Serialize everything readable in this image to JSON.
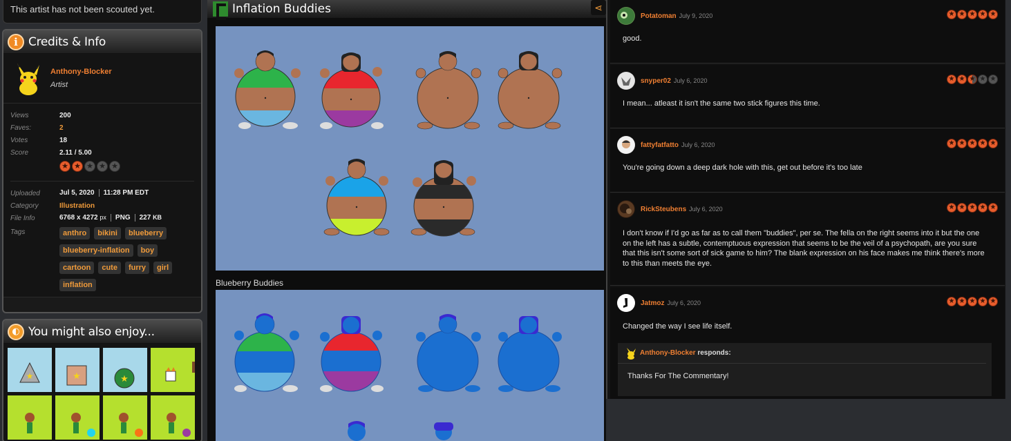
{
  "scout_text": "This artist has not been scouted yet.",
  "credits": {
    "title": "Credits & Info",
    "artist": {
      "name": "Anthony-Blocker",
      "role": "Artist"
    },
    "stats": [
      {
        "key": "Views",
        "value": "200"
      },
      {
        "key": "Faves:",
        "value": "2"
      },
      {
        "key": "Votes",
        "value": "18"
      },
      {
        "key": "Score",
        "value": "2.11 / 5.00"
      }
    ],
    "score_fraction": 0.422,
    "uploaded_label": "Uploaded",
    "uploaded_date": "Jul 5, 2020",
    "uploaded_time": "11:28 PM EDT",
    "category_label": "Category",
    "category_value": "Illustration",
    "fileinfo_label": "File Info",
    "file_dims": "6768 x 4272",
    "file_dims_unit": "px",
    "file_type": "PNG",
    "file_size": "227",
    "file_size_unit": "KB",
    "tags_label": "Tags",
    "tags": [
      "anthro",
      "bikini",
      "blueberry",
      "blueberry-inflation",
      "boy",
      "cartoon",
      "cute",
      "furry",
      "girl",
      "inflation"
    ]
  },
  "enjoy": {
    "title": "You might also enjoy..."
  },
  "submission": {
    "title": "Inflation Buddies",
    "caption": "Blueberry Buddies"
  },
  "comments": [
    {
      "user": "Potatoman",
      "date": "July 9, 2020",
      "stars": 5,
      "text": "good."
    },
    {
      "user": "snyper02",
      "date": "July 6, 2020",
      "stars": 2.5,
      "text": "I mean... atleast it isn't the same two stick figures this time."
    },
    {
      "user": "fattyfatfatto",
      "date": "July 6, 2020",
      "stars": 5,
      "text": "You're going down a deep dark hole with this, get out before it's too late"
    },
    {
      "user": "RickSteubens",
      "date": "July 6, 2020",
      "stars": 5,
      "text": "I don't know if I'd go as far as to call them \"buddies\", per se. The fella on the right seems into it but the one on the left has a subtle, contemptuous expression that seems to be the veil of a psychopath, are you sure that this isn't some sort of sick game to him? The blank expression on his face makes me think there's more to this than meets the eye."
    },
    {
      "user": "Jatmoz",
      "date": "July 6, 2020",
      "stars": 5,
      "text": "Changed the way I see life itself."
    }
  ],
  "response": {
    "user": "Anthony-Blocker",
    "verb": "responds:",
    "text": "Thanks For The Commentary!"
  },
  "colors": {
    "accent": "#ef7f32",
    "tag_text": "#ef9a3a",
    "canvas_bg": "#7693c0",
    "star": "#e85d2c"
  }
}
